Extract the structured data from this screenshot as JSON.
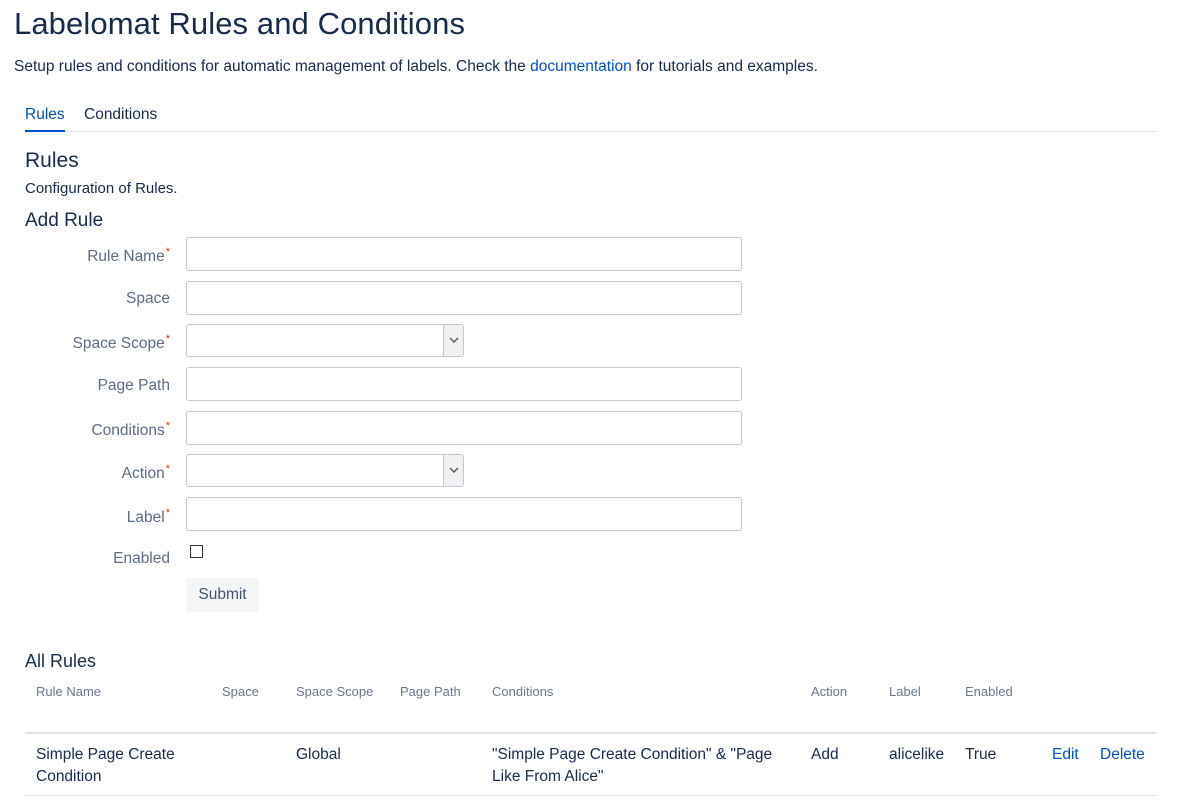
{
  "page": {
    "title": "Labelomat Rules and Conditions",
    "intro_before": "Setup rules and conditions for automatic management of labels. Check the ",
    "intro_link": "documentation",
    "intro_after": " for tutorials and examples."
  },
  "tabs": [
    {
      "label": "Rules",
      "active": true
    },
    {
      "label": "Conditions",
      "active": false
    }
  ],
  "section": {
    "title": "Rules",
    "description": "Configuration of Rules."
  },
  "form": {
    "title": "Add Rule",
    "required_marker": "*",
    "fields": {
      "rule_name": {
        "label": "Rule Name",
        "value": ""
      },
      "space": {
        "label": "Space",
        "value": ""
      },
      "space_scope": {
        "label": "Space Scope",
        "value": ""
      },
      "page_path": {
        "label": "Page Path",
        "value": ""
      },
      "conditions": {
        "label": "Conditions",
        "value": ""
      },
      "action": {
        "label": "Action",
        "value": ""
      },
      "label": {
        "label": "Label",
        "value": ""
      },
      "enabled": {
        "label": "Enabled",
        "checked": false
      }
    },
    "submit_label": "Submit"
  },
  "all_rules": {
    "title": "All Rules",
    "columns": [
      "Rule Name",
      "Space",
      "Space Scope",
      "Page Path",
      "Conditions",
      "Action",
      "Label",
      "Enabled"
    ],
    "rows": [
      {
        "rule_name": "Simple Page Create Condition",
        "space": "",
        "space_scope": "Global",
        "page_path": "",
        "conditions": "\"Simple Page Create Condition\" & \"Page Like From Alice\"",
        "action": "Add",
        "label": "alicelike",
        "enabled": "True",
        "edit_label": "Edit",
        "delete_label": "Delete"
      }
    ]
  },
  "icons": {
    "select_arrow": "chevron-down-icon"
  }
}
